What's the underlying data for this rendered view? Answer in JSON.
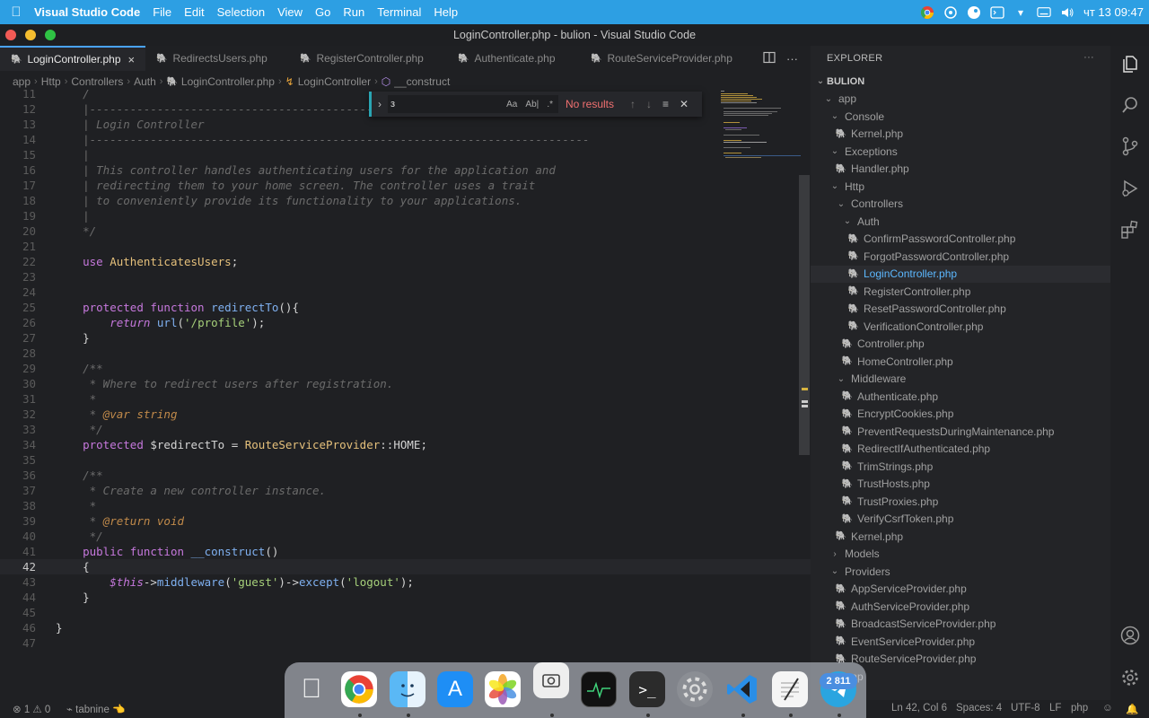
{
  "menubar": {
    "app_name": "Visual Studio Code",
    "menus": [
      "File",
      "Edit",
      "Selection",
      "View",
      "Go",
      "Run",
      "Terminal",
      "Help"
    ],
    "clock": "чт 13 09:47"
  },
  "window": {
    "title": "LoginController.php - bulion - Visual Studio Code"
  },
  "tabs": [
    {
      "label": "LoginController.php",
      "active": true
    },
    {
      "label": "RedirectsUsers.php"
    },
    {
      "label": "RegisterController.php"
    },
    {
      "label": "Authenticate.php"
    },
    {
      "label": "RouteServiceProvider.php"
    }
  ],
  "tab_close": "×",
  "breadcrumb": [
    "app",
    "Http",
    "Controllers",
    "Auth",
    "LoginController.php",
    "LoginController",
    "__construct"
  ],
  "find": {
    "query": "з",
    "match_case": "Aa",
    "whole_word": "Ab|",
    "regex": ".*",
    "result": "No results"
  },
  "code_lines": [
    {
      "n": "11",
      "t": "    /"
    },
    {
      "n": "12",
      "t": "    |--------------------------------------------------------------------------"
    },
    {
      "n": "13",
      "t": "    | Login Controller"
    },
    {
      "n": "14",
      "t": "    |--------------------------------------------------------------------------"
    },
    {
      "n": "15",
      "t": "    |"
    },
    {
      "n": "16",
      "t": "    | This controller handles authenticating users for the application and"
    },
    {
      "n": "17",
      "t": "    | redirecting them to your home screen. The controller uses a trait"
    },
    {
      "n": "18",
      "t": "    | to conveniently provide its functionality to your applications."
    },
    {
      "n": "19",
      "t": "    |"
    },
    {
      "n": "20",
      "t": "    */"
    },
    {
      "n": "21",
      "t": ""
    },
    {
      "n": "22",
      "t": "    use AuthenticatesUsers;"
    },
    {
      "n": "23",
      "t": ""
    },
    {
      "n": "24",
      "t": ""
    },
    {
      "n": "25",
      "t": "    protected function redirectTo(){"
    },
    {
      "n": "26",
      "t": "        return url('/profile');"
    },
    {
      "n": "27",
      "t": "    }"
    },
    {
      "n": "28",
      "t": ""
    },
    {
      "n": "29",
      "t": "    /**"
    },
    {
      "n": "30",
      "t": "     * Where to redirect users after registration."
    },
    {
      "n": "31",
      "t": "     *"
    },
    {
      "n": "32",
      "t": "     * @var string"
    },
    {
      "n": "33",
      "t": "     */"
    },
    {
      "n": "34",
      "t": "    protected $redirectTo = RouteServiceProvider::HOME;"
    },
    {
      "n": "35",
      "t": ""
    },
    {
      "n": "36",
      "t": "    /**"
    },
    {
      "n": "37",
      "t": "     * Create a new controller instance."
    },
    {
      "n": "38",
      "t": "     *"
    },
    {
      "n": "39",
      "t": "     * @return void"
    },
    {
      "n": "40",
      "t": "     */"
    },
    {
      "n": "41",
      "t": "    public function __construct()"
    },
    {
      "n": "42",
      "t": "    {"
    },
    {
      "n": "43",
      "t": "        $this->middleware('guest')->except('logout');"
    },
    {
      "n": "44",
      "t": "    }"
    },
    {
      "n": "45",
      "t": ""
    },
    {
      "n": "46",
      "t": "}"
    },
    {
      "n": "47",
      "t": ""
    }
  ],
  "explorer": {
    "header": "EXPLORER",
    "more": "···",
    "root": "BULION",
    "items": [
      {
        "label": "app",
        "kind": "folder"
      },
      {
        "label": "Console",
        "kind": "folder"
      },
      {
        "label": "Kernel.php",
        "kind": "file"
      },
      {
        "label": "Exceptions",
        "kind": "folder"
      },
      {
        "label": "Handler.php",
        "kind": "file"
      },
      {
        "label": "Http",
        "kind": "folder"
      },
      {
        "label": "Controllers",
        "kind": "folder"
      },
      {
        "label": "Auth",
        "kind": "folder"
      },
      {
        "label": "ConfirmPasswordController.php",
        "kind": "file"
      },
      {
        "label": "ForgotPasswordController.php",
        "kind": "file"
      },
      {
        "label": "LoginController.php",
        "kind": "file",
        "selected": true
      },
      {
        "label": "RegisterController.php",
        "kind": "file"
      },
      {
        "label": "ResetPasswordController.php",
        "kind": "file"
      },
      {
        "label": "VerificationController.php",
        "kind": "file"
      },
      {
        "label": "Controller.php",
        "kind": "file"
      },
      {
        "label": "HomeController.php",
        "kind": "file"
      },
      {
        "label": "Middleware",
        "kind": "folder"
      },
      {
        "label": "Authenticate.php",
        "kind": "file"
      },
      {
        "label": "EncryptCookies.php",
        "kind": "file"
      },
      {
        "label": "PreventRequestsDuringMaintenance.php",
        "kind": "file"
      },
      {
        "label": "RedirectIfAuthenticated.php",
        "kind": "file"
      },
      {
        "label": "TrimStrings.php",
        "kind": "file"
      },
      {
        "label": "TrustHosts.php",
        "kind": "file"
      },
      {
        "label": "TrustProxies.php",
        "kind": "file"
      },
      {
        "label": "VerifyCsrfToken.php",
        "kind": "file"
      },
      {
        "label": "Kernel.php",
        "kind": "file"
      },
      {
        "label": "Models",
        "kind": "folder-collapsed"
      },
      {
        "label": "Providers",
        "kind": "folder"
      },
      {
        "label": "AppServiceProvider.php",
        "kind": "file"
      },
      {
        "label": "AuthServiceProvider.php",
        "kind": "file"
      },
      {
        "label": "BroadcastServiceProvider.php",
        "kind": "file"
      },
      {
        "label": "EventServiceProvider.php",
        "kind": "file"
      },
      {
        "label": "RouteServiceProvider.php",
        "kind": "file"
      },
      {
        "label": "trap",
        "kind": "folder-collapsed"
      }
    ]
  },
  "status": {
    "problems": "⊗ 1 ⚠ 0",
    "tabnine": "⌁ tabnine 👈",
    "position": "Ln 42, Col 6",
    "spaces": "Spaces: 4",
    "encoding": "UTF-8",
    "eol": "LF",
    "language": "php"
  },
  "dock": {
    "badge": "2 811"
  }
}
